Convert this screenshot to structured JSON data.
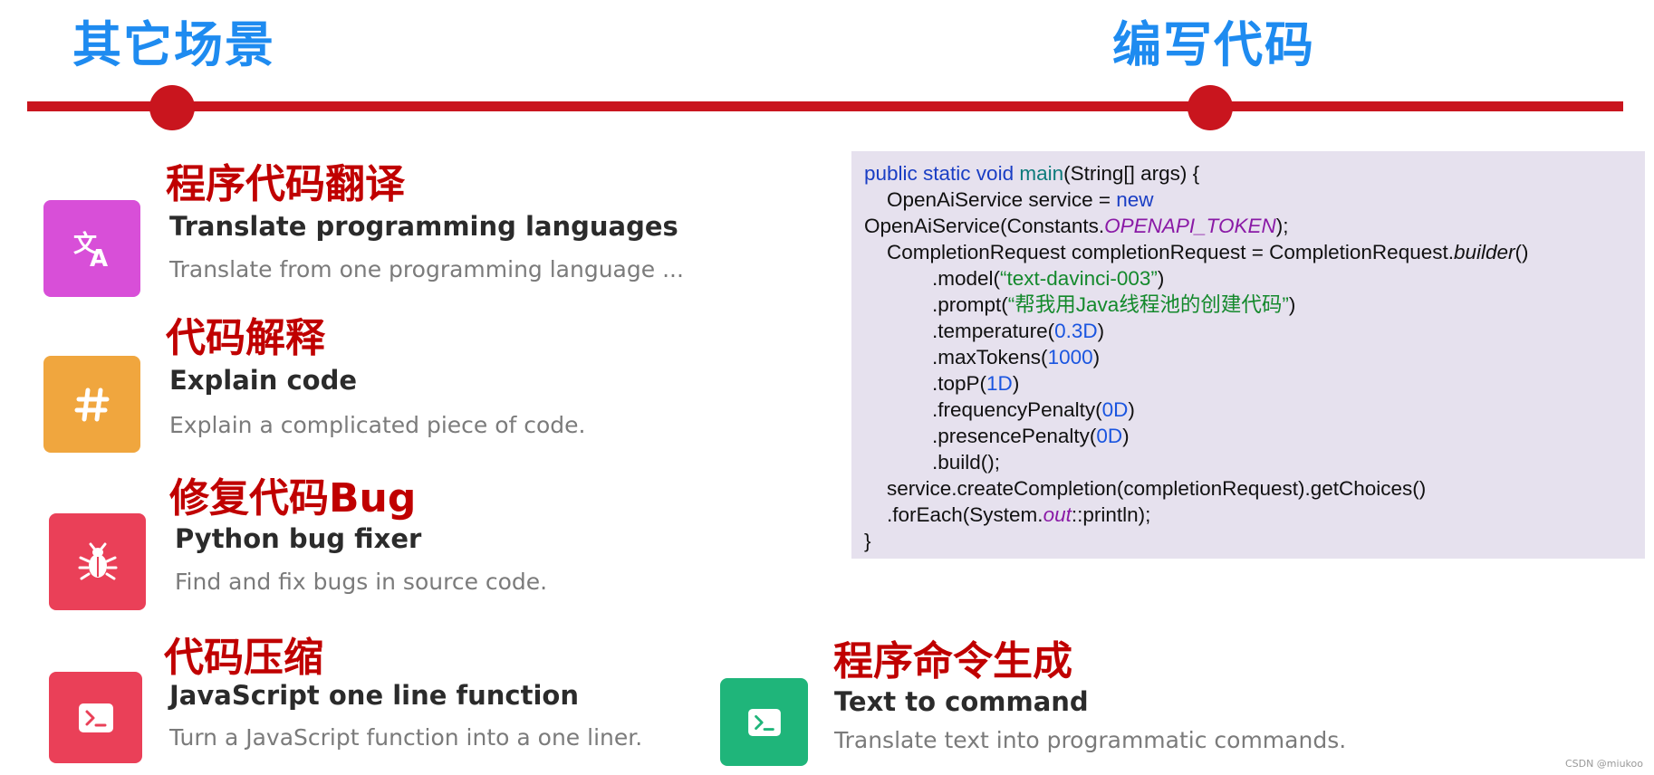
{
  "headings": {
    "left": "其它场景",
    "right": "编写代码"
  },
  "cards": {
    "translate": {
      "zh_title": "程序代码翻译",
      "title": "Translate programming languages",
      "description": "Translate from one programming language ...",
      "icon": "translate-icon",
      "color": "#d84fd8"
    },
    "explain": {
      "zh_title": "代码解释",
      "title": "Explain code",
      "description": "Explain a complicated piece of code.",
      "icon": "hash-icon",
      "color": "#f0a63e"
    },
    "bugfix": {
      "zh_title": "修复代码Bug",
      "title": "Python bug fixer",
      "description": "Find and fix bugs in source code.",
      "icon": "bug-icon",
      "color": "#ea4058"
    },
    "compress": {
      "zh_title": "代码压缩",
      "title": "JavaScript one line function",
      "description": "Turn a JavaScript function into a one liner.",
      "icon": "terminal-icon",
      "color": "#ea4058"
    },
    "command": {
      "zh_title": "程序命令生成",
      "title": "Text to command",
      "description": "Translate text into programmatic commands.",
      "icon": "terminal-icon",
      "color": "#1fb57a"
    }
  },
  "code": {
    "l1_kw": "public static void ",
    "l1_fn": "main",
    "l1_rest": "(String[] args) {",
    "l2_text": "    OpenAiService service = ",
    "l2_kw": "new",
    "l3_text": "OpenAiService(Constants.",
    "l3_const": "OPENAPI_TOKEN",
    "l3_end": ");",
    "l4_text": "    CompletionRequest completionRequest = CompletionRequest.",
    "l4_it": "builder",
    "l4_end": "()",
    "l5_text": "            .model(",
    "l5_str": "“text-davinci-003”",
    "l5_end": ")",
    "l6_text": "            .prompt(",
    "l6_str": "“帮我用Java线程池的创建代码”",
    "l6_end": ")",
    "l7_text": "            .temperature(",
    "l7_num": "0.3D",
    "l7_end": ")",
    "l8_text": "            .maxTokens(",
    "l8_num": "1000",
    "l8_end": ")",
    "l9_text": "            .topP(",
    "l9_num": "1D",
    "l9_end": ")",
    "l10_text": "            .frequencyPenalty(",
    "l10_num": "0D",
    "l10_end": ")",
    "l11_text": "            .presencePenalty(",
    "l11_num": "0D",
    "l11_end": ")",
    "l12_text": "            .build();",
    "l13_text": "    service.createCompletion(completionRequest).getChoices()",
    "l14_text": "    .forEach(System.",
    "l14_const": "out",
    "l14_end": "::println);",
    "l15_text": "}"
  },
  "watermark": "CSDN @miukoo"
}
